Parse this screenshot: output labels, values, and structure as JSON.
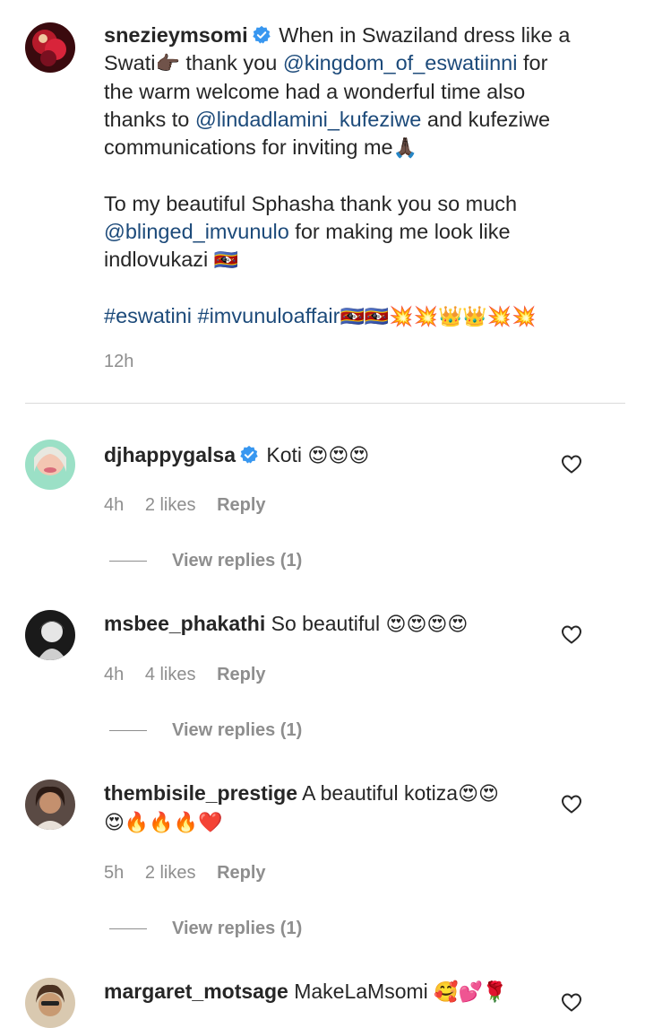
{
  "post": {
    "username": "snezieymsomi",
    "lines": [
      {
        "parts": [
          {
            "t": "text",
            "v": "When in Swaziland dress like a"
          }
        ]
      },
      {
        "parts": [
          {
            "t": "text",
            "v": "Swati"
          },
          {
            "t": "emoji",
            "v": "👉🏿"
          },
          {
            "t": "text",
            "v": " thank you "
          },
          {
            "t": "mention",
            "v": "@kingdom_of_eswatiinni"
          },
          {
            "t": "text",
            "v": " for"
          }
        ]
      },
      {
        "parts": [
          {
            "t": "text",
            "v": "the warm welcome had a wonderful time also"
          }
        ]
      },
      {
        "parts": [
          {
            "t": "text",
            "v": "thanks to "
          },
          {
            "t": "mention",
            "v": "@lindadlamini_kufeziwe"
          },
          {
            "t": "text",
            "v": " and kufeziwe"
          }
        ]
      },
      {
        "parts": [
          {
            "t": "text",
            "v": "communications for inviting me"
          },
          {
            "t": "emoji",
            "v": "🙏🏿"
          }
        ]
      }
    ],
    "para2": [
      {
        "parts": [
          {
            "t": "text",
            "v": "To my beautiful Sphasha thank you so much"
          }
        ]
      },
      {
        "parts": [
          {
            "t": "mention",
            "v": "@blinged_imvunulo"
          },
          {
            "t": "text",
            "v": " for making me look like"
          }
        ]
      },
      {
        "parts": [
          {
            "t": "text",
            "v": "indlovukazi "
          },
          {
            "t": "emoji",
            "v": "🇸🇿"
          }
        ]
      }
    ],
    "hashtags": [
      {
        "t": "hashtag",
        "v": "#eswatini"
      },
      {
        "t": "text",
        "v": " "
      },
      {
        "t": "hashtag",
        "v": "#imvunuloaffair"
      },
      {
        "t": "emoji",
        "v": "🇸🇿🇸🇿💥💥👑👑💥💥"
      }
    ],
    "time": "12h"
  },
  "comments": [
    {
      "username": "djhappygalsa",
      "verified": true,
      "lines": [
        [
          "Koti ",
          "😍😍😍"
        ]
      ],
      "time": "4h",
      "likes": "2 likes",
      "reply": "Reply",
      "view_replies": "View replies (1)"
    },
    {
      "username": "msbee_phakathi",
      "verified": false,
      "lines": [
        [
          "So beautiful ",
          "😍😍😍😍"
        ]
      ],
      "time": "4h",
      "likes": "4 likes",
      "reply": "Reply",
      "view_replies": "View replies (1)"
    },
    {
      "username": "thembisile_prestige",
      "verified": false,
      "lines": [
        [
          "A beautiful kotiza",
          "😍😍"
        ],
        [
          "",
          "😍🔥🔥🔥❤️"
        ]
      ],
      "time": "5h",
      "likes": "2 likes",
      "reply": "Reply",
      "view_replies": "View replies (1)"
    },
    {
      "username": "margaret_motsage",
      "verified": false,
      "lines": [
        [
          "MakeLaMsomi ",
          "🥰💕🌹"
        ]
      ],
      "time": "",
      "likes": "",
      "reply": "",
      "view_replies": ""
    }
  ],
  "colors": {
    "mention": "#1c4a7a",
    "muted": "#8e8e8e",
    "verified": "#3897f0"
  }
}
